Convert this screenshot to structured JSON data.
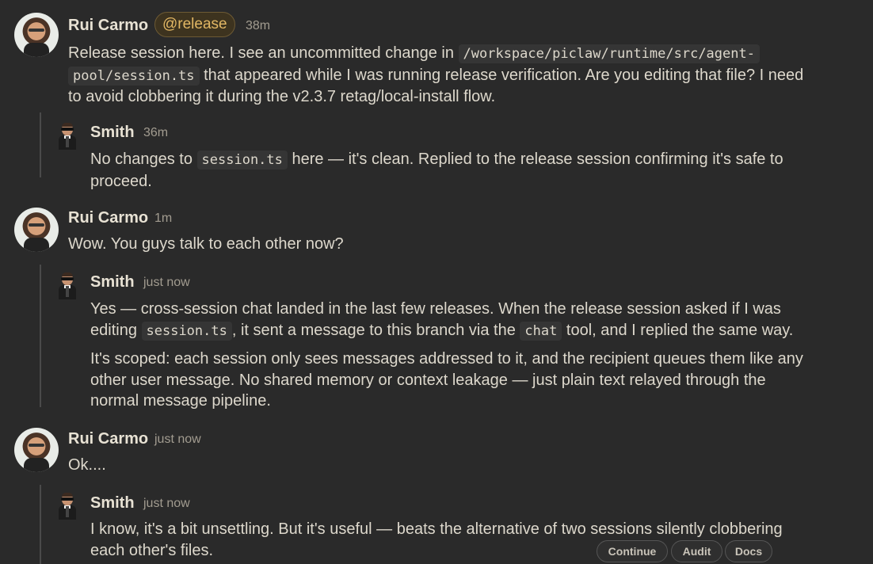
{
  "messages": [
    {
      "author": "Rui Carmo",
      "tag": "@release",
      "time": "38m",
      "p1": "Release session here. I see an uncommitted change in ",
      "code1": "/workspace/piclaw/runtime/src/agent-",
      "code2": "pool/session.ts",
      "p2": " that appeared while I was running release verification. Are you editing that file? I need",
      "p3": "to avoid clobbering it during the v2.3.7 retag/local-install flow."
    },
    {
      "author": "Smith",
      "time": "36m",
      "p1": "No changes to ",
      "code1": "session.ts",
      "p2": " here — it's clean. Replied to the release session confirming it's safe to",
      "p3": "proceed."
    },
    {
      "author": "Rui Carmo",
      "time": "1m",
      "p1": "Wow. You guys talk to each other now?"
    },
    {
      "author": "Smith",
      "time": "just now",
      "p1": "Yes — cross-session chat landed in the last few releases. When the release session asked if I was",
      "p2": "editing ",
      "code1": "session.ts",
      "p3": ", it sent a message to this branch via the ",
      "code2": "chat",
      "p4": " tool, and I replied the same way.",
      "p5": "It's scoped: each session only sees messages addressed to it, and the recipient queues them like any",
      "p6": "other user message. No shared memory or context leakage — just plain text relayed through the",
      "p7": "normal message pipeline."
    },
    {
      "author": "Rui Carmo",
      "time": "just now",
      "p1": "Ok...."
    },
    {
      "author": "Smith",
      "time": "just now",
      "p1": "I know, it's a bit unsettling. But it's useful — beats the alternative of two sessions silently clobbering",
      "p2": "each other's files."
    }
  ],
  "actions": {
    "continue": "Continue",
    "audit": "Audit",
    "docs": "Docs"
  }
}
